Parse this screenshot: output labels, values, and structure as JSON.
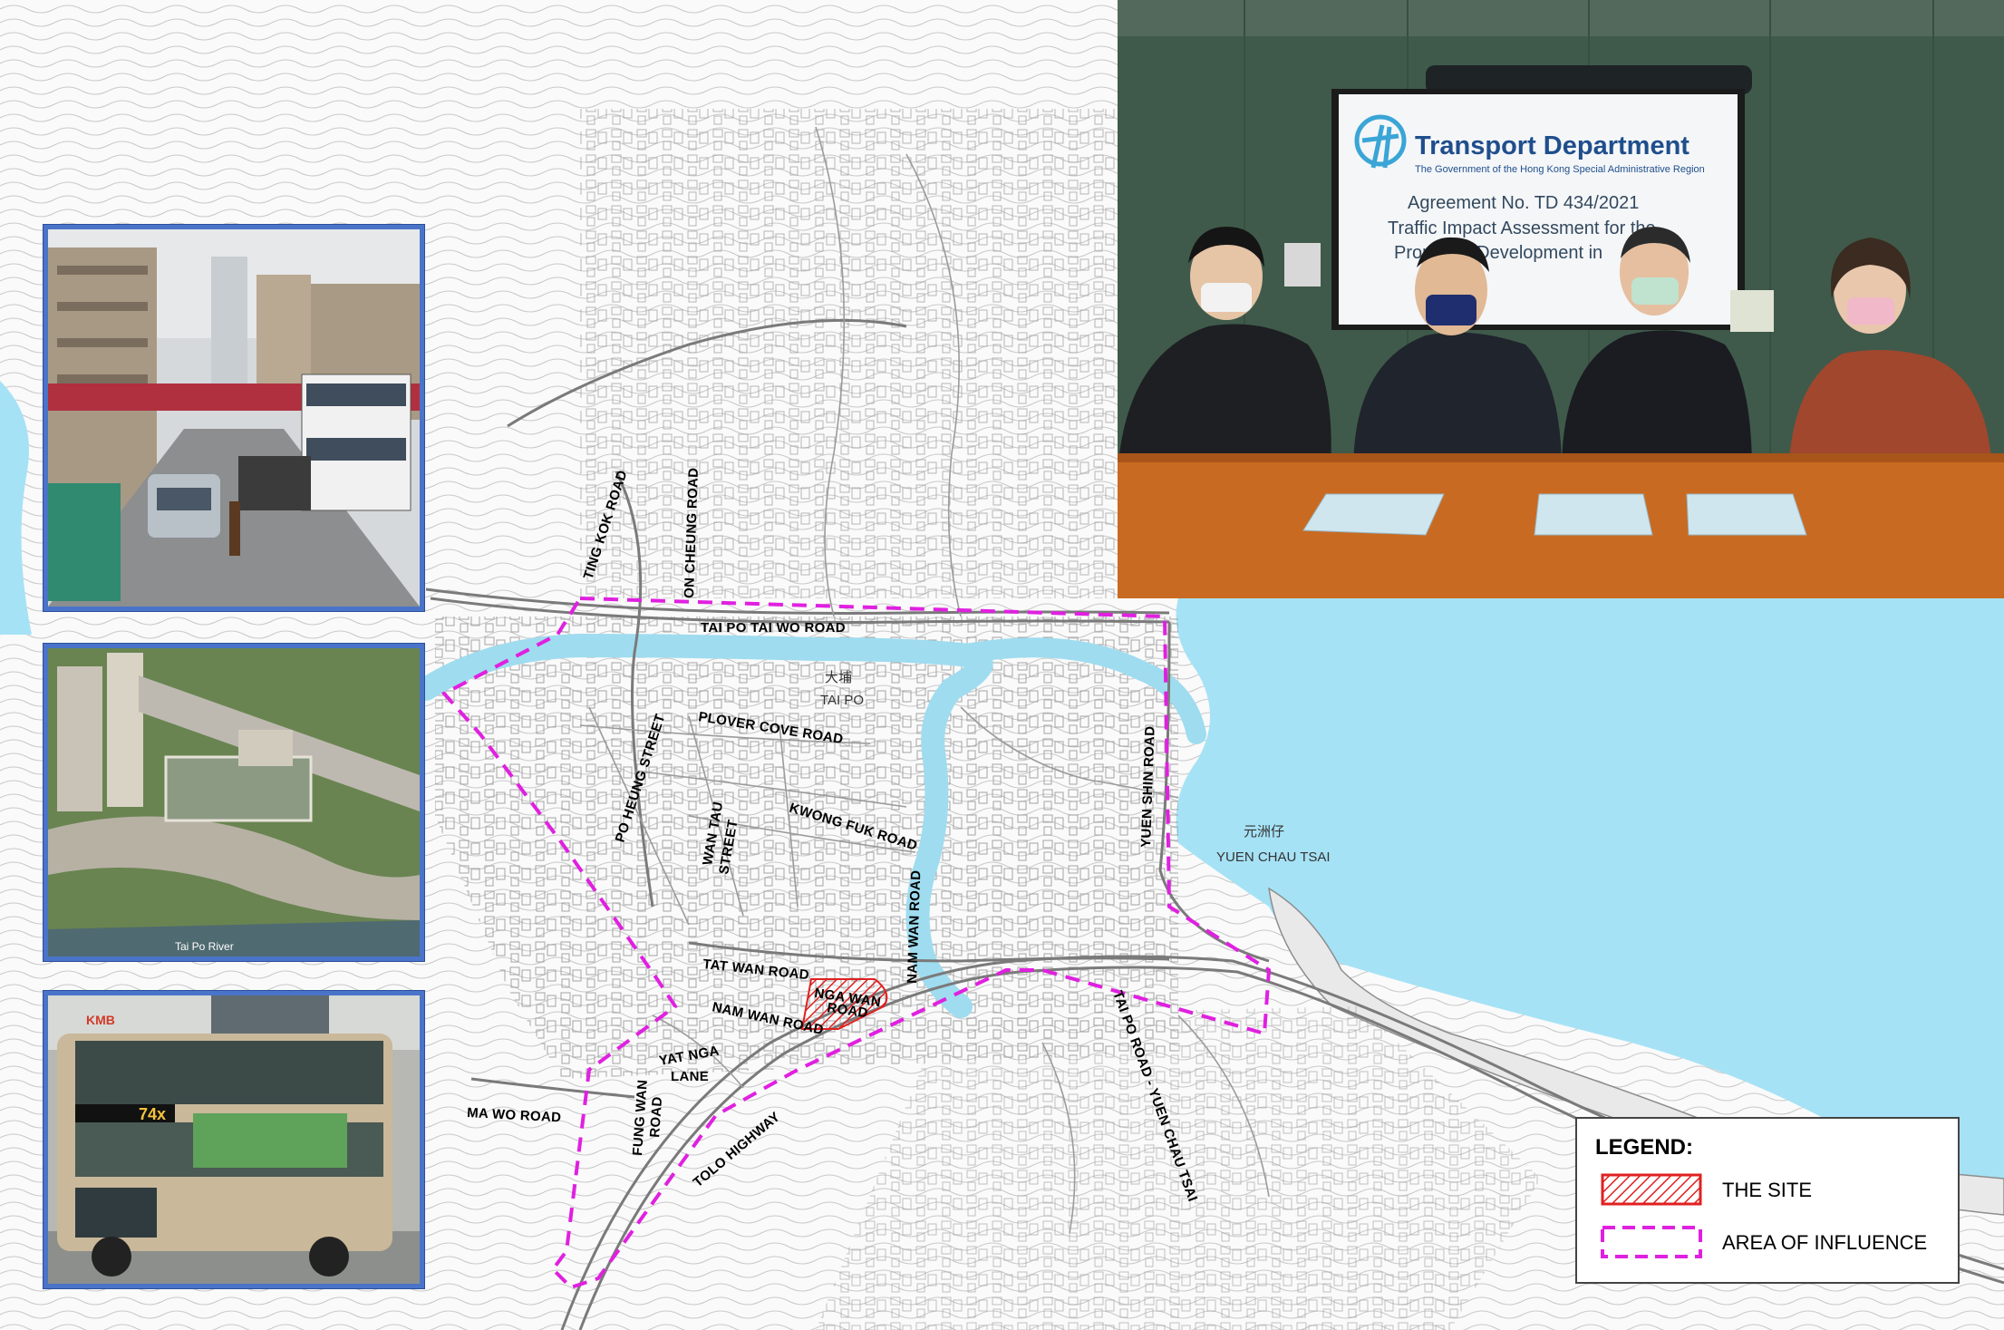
{
  "photos": {
    "street_scene": "Tai Po street scene",
    "aerial_view": "Aerial view of Tai Po",
    "aerial_caption": "Tai Po River",
    "bus": {
      "route_number": "74x",
      "operator": "KMB"
    }
  },
  "meeting": {
    "logo_title": "Transport Department",
    "logo_subtitle": "The Government of the Hong Kong Special Administrative Region",
    "slide_line1": "Agreement No. TD 434/2021",
    "slide_line2": "Traffic Impact Assessment for the",
    "slide_line3": "Proposed Development in"
  },
  "map": {
    "district_label": "TAI PO",
    "district_label_cn": "大埔",
    "place_label": "YUEN CHAU TSAI",
    "place_label_cn": "元洲仔",
    "roads": {
      "ting_kok": "TING KOK ROAD",
      "on_cheung": "ON CHEUNG ROAD",
      "tai_po_tai_wo": "TAI PO TAI WO ROAD",
      "plover_cove": "PLOVER COVE ROAD",
      "po_heung": "PO HEUNG STREET",
      "wan_tau_1": "WAN TAU",
      "wan_tau_2": "STREET",
      "kwong_fuk": "KWONG FUK ROAD",
      "yuen_shin": "YUEN SHIN ROAD",
      "nam_wan_vertical": "NAM WAN ROAD",
      "tat_wan": "TAT WAN ROAD",
      "nga_wan_1": "NGA WAN",
      "nga_wan_2": "ROAD",
      "nam_wan": "NAM WAN ROAD",
      "yat_nga_1": "YAT NGA",
      "yat_nga_2": "LANE",
      "ma_wo": "MA WO ROAD",
      "fung_wan_1": "FUNG WAN",
      "fung_wan_2": "ROAD",
      "tolo": "TOLO HIGHWAY",
      "tai_po_road_yct": "TAI PO ROAD - YUEN CHAU TSAI"
    }
  },
  "legend": {
    "title": "LEGEND:",
    "site": "THE SITE",
    "influence": "AREA OF INFLUENCE"
  },
  "colors": {
    "water": "#a6e2f5",
    "river": "#9fdcef",
    "influence_boundary": "#e020e0",
    "site_hatch": "#e02020",
    "frame": "#4a74c9",
    "wall_green": "#3f5a4a",
    "table_orange": "#c96a22"
  }
}
